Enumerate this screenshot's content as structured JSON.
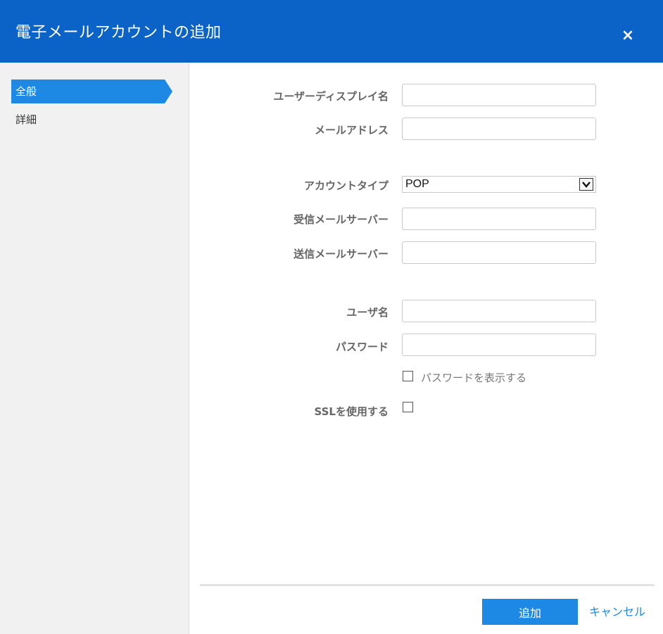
{
  "dialog": {
    "title": "電子メールアカウントの追加",
    "close_label": "×"
  },
  "sidebar": {
    "items": [
      {
        "label": "全般",
        "active": true
      },
      {
        "label": "詳細",
        "active": false
      }
    ]
  },
  "form": {
    "display_name_label": "ユーザーディスプレイ名",
    "display_name_value": "",
    "email_label": "メールアドレス",
    "email_value": "",
    "account_type_label": "アカウントタイプ",
    "account_type_value": "POP",
    "incoming_label": "受信メールサーバー",
    "incoming_value": "",
    "outgoing_label": "送信メールサーバー",
    "outgoing_value": "",
    "username_label": "ユーザ名",
    "username_value": "",
    "password_label": "パスワード",
    "password_value": "",
    "show_password_label": "パスワードを表示する",
    "show_password_checked": false,
    "ssl_label": "SSLを使用する",
    "ssl_checked": false
  },
  "footer": {
    "add_label": "追加",
    "cancel_label": "キャンセル"
  },
  "colors": {
    "header": "#0b63c8",
    "accent": "#1e88e5",
    "sidebar_bg": "#f1f1f1"
  }
}
